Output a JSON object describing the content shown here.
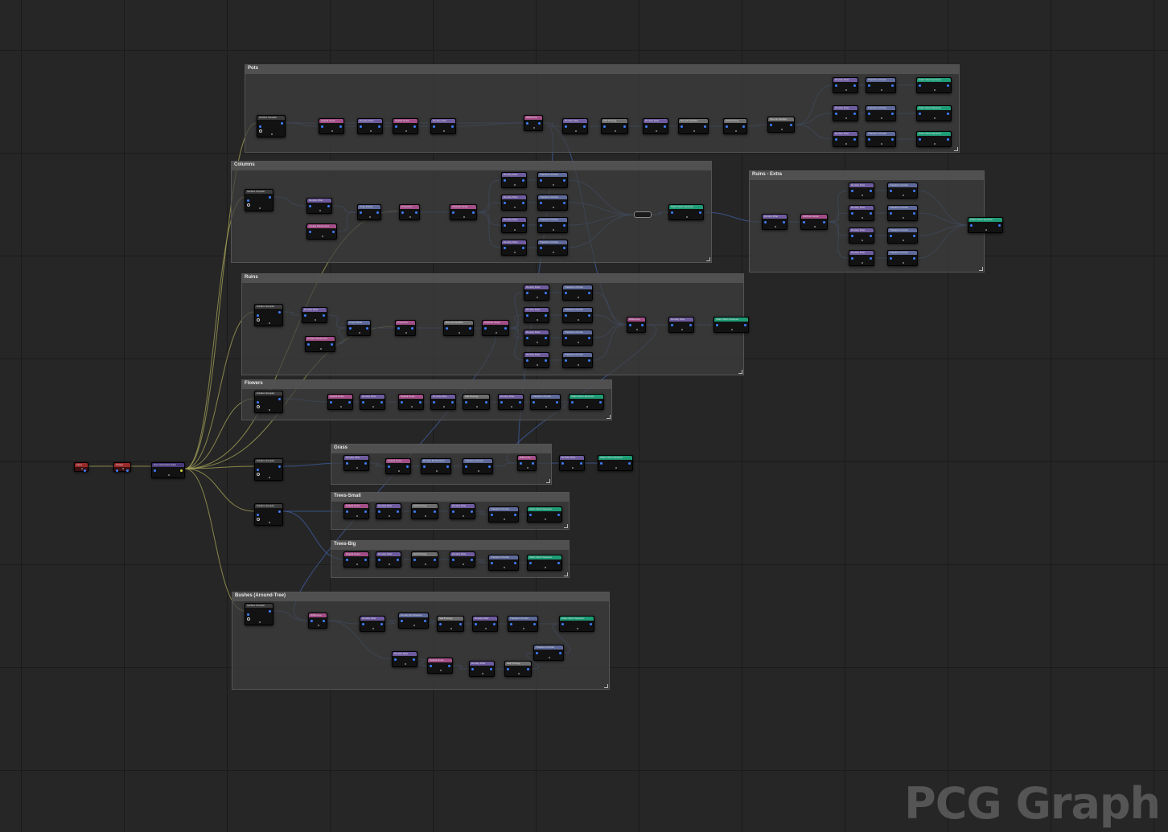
{
  "app": {
    "watermark": "PCG Graph"
  },
  "colors": {
    "filter": "#6e5c9e",
    "noise": "#a34e87",
    "transform": "#5f6a9a",
    "spawner": "#1e9c76",
    "utility": "#6e6e6e",
    "sampler": "#3b3b3b",
    "source": "#9a2a2a",
    "wire_landscape": "#a8a65a",
    "wire_points": "#3f62a8"
  },
  "comments": {
    "pots": "Pots",
    "columns": "Columns",
    "ruins": "Ruins",
    "ruins_extra": "Ruins - Extra",
    "flowers": "Flowers",
    "grass": "Grass",
    "trees_small": "Trees-Small",
    "trees_big": "Trees-Big",
    "bushes": "Bushes (Around-Tree)"
  },
  "node_types": {
    "input": "Input",
    "output": "Output",
    "get_landscape": "Get Landscape Data",
    "surface_sampler": "Surface Sampler",
    "density_filter": "Density Filter",
    "spatial_noise": "Spatial Noise",
    "transform_points": "Transform Points",
    "static_mesh_spawner": "Static Mesh Spawner",
    "self_pruning": "Self Pruning",
    "bounds_modifier": "Bounds Modifier",
    "attribute_noise": "Attribute Noise",
    "difference": "Difference",
    "copy_points": "Copy Points",
    "create_points_grid": "Create Points Grid",
    "projection": "Projection",
    "density_by_distance": "Density By Distance"
  }
}
